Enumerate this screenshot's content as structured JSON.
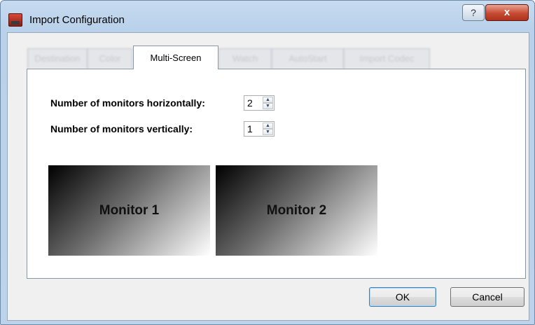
{
  "window": {
    "title": "Import Configuration",
    "help_glyph": "?",
    "close_glyph": "x",
    "app_icon": "app-icon"
  },
  "tabs": [
    {
      "label": "Destination",
      "active": false
    },
    {
      "label": "Color",
      "active": false
    },
    {
      "label": "Multi-Screen",
      "active": true
    },
    {
      "label": "Watch",
      "active": false
    },
    {
      "label": "AutoStart",
      "active": false
    },
    {
      "label": "Import Codec",
      "active": false
    }
  ],
  "multiscreen": {
    "horizontal_label": "Number of monitors horizontally:",
    "horizontal_value": "2",
    "vertical_label": "Number of monitors vertically:",
    "vertical_value": "1",
    "monitors": [
      "Monitor 1",
      "Monitor 2"
    ]
  },
  "buttons": {
    "ok": "OK",
    "cancel": "Cancel"
  }
}
